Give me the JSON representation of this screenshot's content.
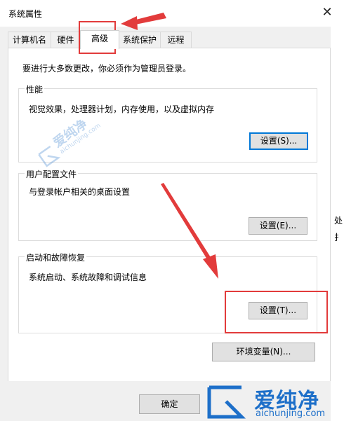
{
  "window": {
    "title": "系统属性",
    "close_glyph": "✕"
  },
  "tabs": [
    {
      "label": "计算机名",
      "active": false
    },
    {
      "label": "硬件",
      "active": false
    },
    {
      "label": "高级",
      "active": true
    },
    {
      "label": "系统保护",
      "active": false
    },
    {
      "label": "远程",
      "active": false
    }
  ],
  "intro": "要进行大多数更改，你必须作为管理员登录。",
  "performance": {
    "title": "性能",
    "desc": "视觉效果，处理器计划，内存使用，以及虚拟内存",
    "button": "设置(S)..."
  },
  "profiles": {
    "title": "用户配置文件",
    "desc": "与登录帐户相关的桌面设置",
    "button": "设置(E)..."
  },
  "startup": {
    "title": "启动和故障恢复",
    "desc": "系统启动、系统故障和调试信息",
    "button": "设置(T)..."
  },
  "env_button": "环境变量(N)...",
  "ok_button": "确定",
  "side_glyphs": [
    "处",
    "扌"
  ],
  "watermark": {
    "cn": "爱纯净",
    "en": "aichunjing.com"
  },
  "colors": {
    "annotation_red": "#e23b3b",
    "focus_blue": "#0078d7",
    "watermark_blue": "#1d6fc9"
  }
}
